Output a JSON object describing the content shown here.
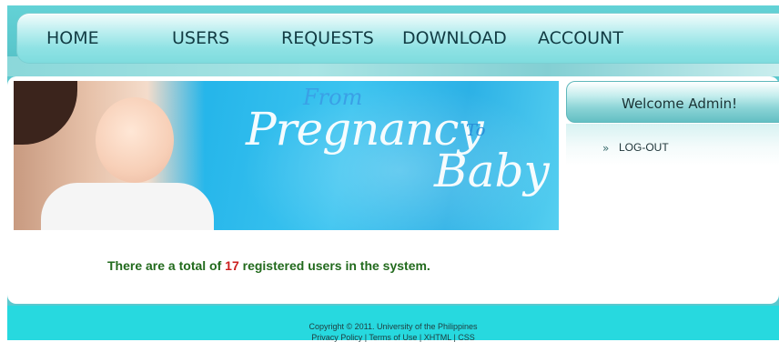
{
  "nav": {
    "items": [
      {
        "label": "HOME"
      },
      {
        "label": "USERS"
      },
      {
        "label": "REQUESTS"
      },
      {
        "label": "DOWNLOAD"
      },
      {
        "label": "ACCOUNT"
      }
    ]
  },
  "banner": {
    "from": "From",
    "pregnancy": "Pregnancy",
    "to": "To",
    "baby": "Baby"
  },
  "sidebar": {
    "welcome": "Welcome Admin!",
    "chevron": "»",
    "logout": "LOG-OUT"
  },
  "message": {
    "prefix": "There are a total of ",
    "count": "17",
    "suffix": " registered users in the system."
  },
  "footer": {
    "copyright": "Copyright © 2011. University of the Philippines",
    "links": [
      {
        "label": "Privacy Policy"
      },
      {
        "label": "Terms of Use"
      },
      {
        "label": "XHTML"
      },
      {
        "label": "CSS"
      }
    ],
    "separator": " | "
  },
  "colors": {
    "nav_text": "#123c44",
    "message_text": "#226a1d",
    "count_text": "#cc1f1f",
    "footer_bg": "#27d9df"
  }
}
